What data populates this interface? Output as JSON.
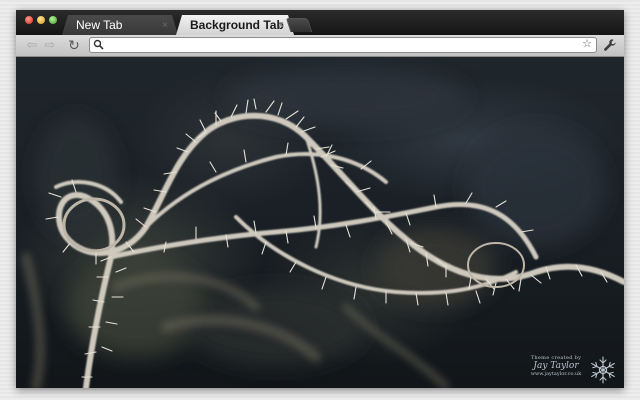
{
  "browser": {
    "tabs": [
      {
        "label": "New Tab",
        "close": "×",
        "active": true
      },
      {
        "label": "Background Tab",
        "close": "×",
        "active": false
      }
    ],
    "toolbar": {
      "back_icon": "back-arrow-icon",
      "forward_icon": "forward-arrow-icon",
      "reload_icon": "reload-icon",
      "back_glyph": "⇦",
      "forward_glyph": "⇨",
      "reload_glyph": "↻",
      "star_glyph": "☆",
      "wrench_icon": "wrench-icon"
    },
    "omnibox": {
      "value": "",
      "placeholder": ""
    }
  },
  "wallpaper": {
    "description_icon": "frosted-branch-photo",
    "credit": {
      "line1": "Theme created by",
      "line2": "Jay Taylor",
      "line3": "www.jaytaylor.co.uk"
    }
  },
  "colors": {
    "tabstrip": "#1f1f1f",
    "active_tab": "#404040",
    "background_tab": "#e4e4e4",
    "toolbar": "#cfcfcf"
  }
}
